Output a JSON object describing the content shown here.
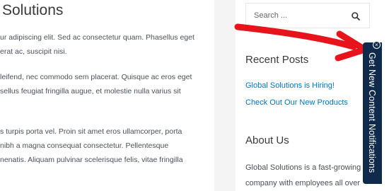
{
  "main": {
    "title": "Solutions",
    "paragraphs": [
      [
        "ur adipiscing elit. Sed ac consectetur quam. Phasellus eget",
        "erat ac, suscipit nisi."
      ],
      [
        "leifend, nec commodo sem placerat. Quisque ac eros eget",
        "sellus feugiat fringilla augue, et molestie nulla varius sit"
      ],
      [
        "s turpis porta vel. Proin sit amet eros ullamcorper, porta",
        "nibh a magna consequat consectetur. Pellentesque",
        "nenatis. Aliquam pulvinar scelerisque felis, vitae fringilla"
      ]
    ]
  },
  "sidebar": {
    "search_placeholder": "Search ...",
    "recent_posts_title": "Recent Posts",
    "recent_posts": [
      "Global Solutions is Hiring!",
      "Check Out Our New Products"
    ],
    "about_title": "About Us",
    "about_lines": [
      "Global Solutions is a fast-growing",
      "company with employees all over"
    ]
  },
  "notification_tab": {
    "label": "Get New Content Notifications",
    "close_symbol": "×"
  },
  "colors": {
    "link": "#0274be",
    "tab_background": "#102a4c",
    "arrow": "#e8141b"
  }
}
